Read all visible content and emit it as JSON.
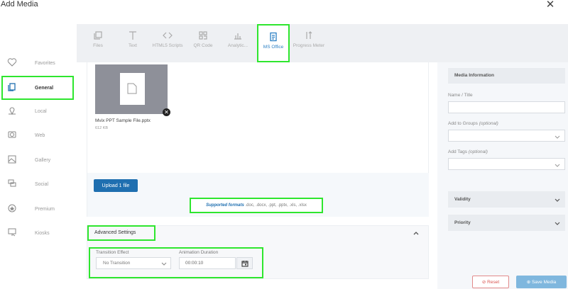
{
  "dialog": {
    "title": "Add Media"
  },
  "nav": {
    "items": [
      {
        "label": "Favorites",
        "icon": "heart-star-icon"
      },
      {
        "label": "General",
        "icon": "copy-icon"
      },
      {
        "label": "Local",
        "icon": "location-icon"
      },
      {
        "label": "Web",
        "icon": "globe-icon"
      },
      {
        "label": "Gallery",
        "icon": "gallery-icon"
      },
      {
        "label": "Social",
        "icon": "chat-icon"
      },
      {
        "label": "Premium",
        "icon": "star-circle-icon"
      },
      {
        "label": "Kiosks",
        "icon": "kiosk-icon"
      }
    ],
    "active": "General"
  },
  "toolbar": {
    "tools": [
      {
        "label": "Files",
        "icon": "files-icon"
      },
      {
        "label": "Text",
        "icon": "text-icon"
      },
      {
        "label": "HTML5 Scripts",
        "icon": "code-icon"
      },
      {
        "label": "QR Code",
        "icon": "qr-icon"
      },
      {
        "label": "Analytic...",
        "icon": "analytics-icon"
      },
      {
        "label": "MS Office",
        "icon": "office-icon"
      },
      {
        "label": "Progress Meter",
        "icon": "progress-icon"
      }
    ],
    "active": "MS Office"
  },
  "file": {
    "name": "Mvix PPT Sample File.pptx",
    "size": "612 KB"
  },
  "upload": {
    "button_label": "Upload 1 file",
    "supported_label": "Supported formats",
    "supported_list": ".doc, .docx, .ppt, .pptx, .xls, .xlsx"
  },
  "advanced": {
    "title": "Advanced Settings",
    "transition_label": "Transition Effect",
    "transition_value": "No Transition",
    "duration_label": "Animation Duration",
    "duration_value": "00:00:10"
  },
  "right": {
    "info_title": "Media Information",
    "name_label": "Name / Title",
    "groups_label": "Add to Groups",
    "tags_label": "Add Tags",
    "optional": "(optional)",
    "validity": "Validity",
    "priority": "Priority",
    "reset_label": "Reset",
    "save_label": "Save Media"
  },
  "colors": {
    "accent": "#1f6fb0",
    "highlight": "#2ee62e",
    "reset": "#d9534f",
    "save": "#7fb7de"
  }
}
